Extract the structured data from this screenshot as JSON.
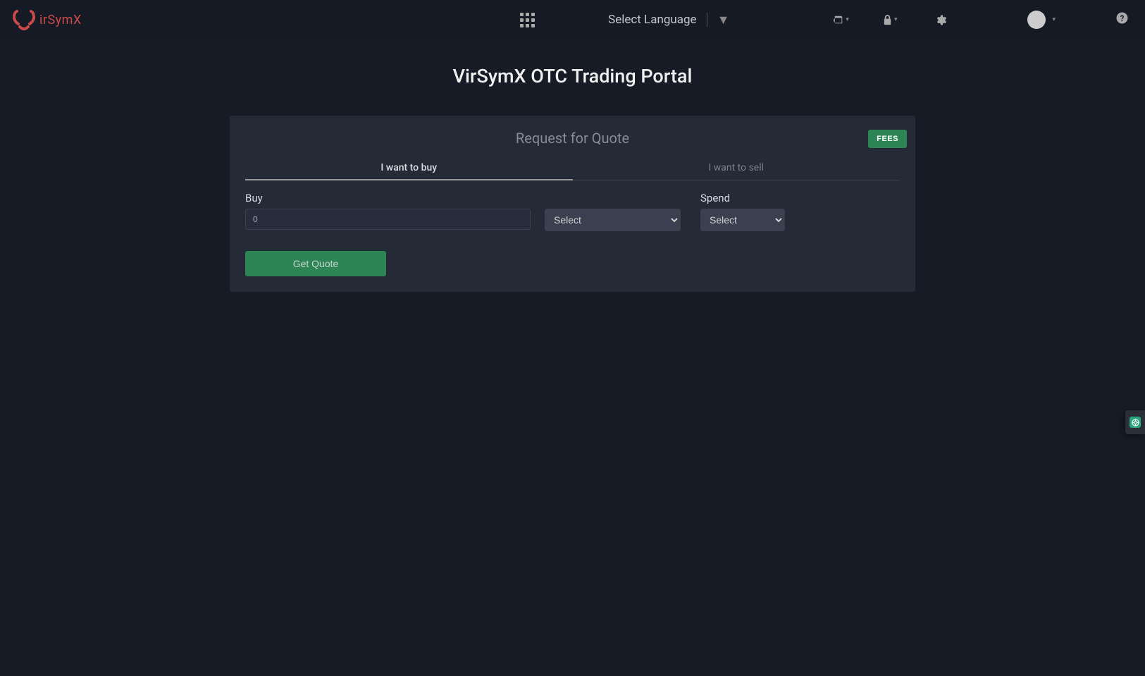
{
  "header": {
    "logo_text": "irSymX",
    "language_label": "Select Language"
  },
  "page": {
    "title": "VirSymX OTC Trading Portal"
  },
  "card": {
    "title": "Request for Quote",
    "fees_button": "FEES",
    "tabs": {
      "buy": "I want to buy",
      "sell": "I want to sell"
    },
    "form": {
      "buy_label": "Buy",
      "buy_value": "0",
      "spend_label": "Spend",
      "select_placeholder": "Select",
      "get_quote_button": "Get Quote"
    }
  }
}
